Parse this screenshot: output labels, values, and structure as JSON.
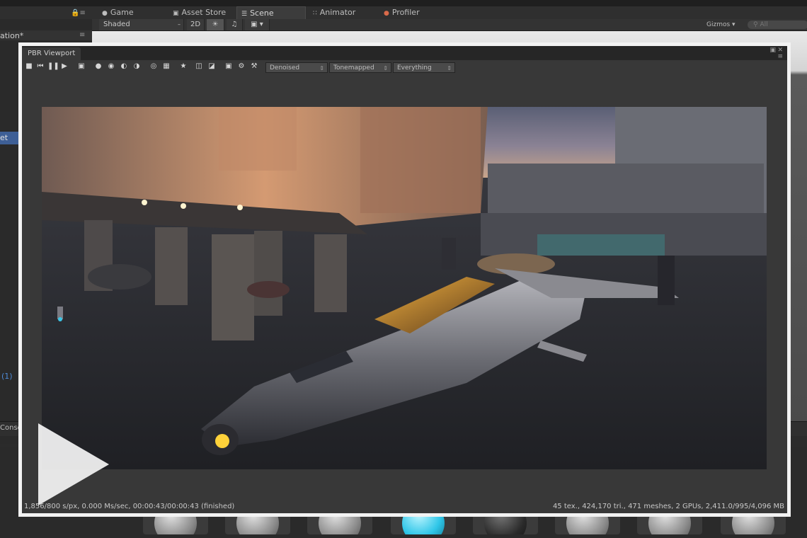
{
  "editor": {
    "tabs": [
      {
        "label": "Game",
        "icon": "gamepad-icon"
      },
      {
        "label": "Asset Store",
        "icon": "bag-icon"
      },
      {
        "label": "Scene",
        "icon": "grid-icon"
      },
      {
        "label": "Animator",
        "icon": "nodes-icon"
      },
      {
        "label": "Profiler",
        "icon": "pie-icon"
      }
    ],
    "scene_toolbar": {
      "shading": "Shaded",
      "mode_2d": "2D",
      "gizmos": "Gizmos",
      "search_placeholder": "All"
    },
    "left_panel": {
      "title": "ation*",
      "selected_row": "et",
      "blue_text": "(1)"
    },
    "console_tab": "Conso"
  },
  "viewport": {
    "title": "PBR Viewport",
    "dropdowns": {
      "denoise": "Denoised",
      "tonemap": "Tonemapped",
      "layers": "Everything"
    },
    "status_left": "1,856/800 s/px, 0.000 Ms/sec, 00:00:43/00:00:43 (finished)",
    "status_right": "45 tex., 424,170 tri., 471 meshes, 2 GPUs, 2,411.0/995/4,096 MB"
  },
  "colors": {
    "panel": "#383838",
    "frame": "#f2f2f2",
    "selection": "#3e5f96"
  }
}
